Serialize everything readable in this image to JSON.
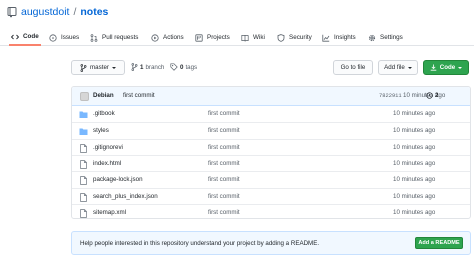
{
  "repo": {
    "owner": "augustdoit",
    "separator": "/",
    "name": "notes"
  },
  "tabs": [
    {
      "label": "Code",
      "icon": "code-icon",
      "active": true
    },
    {
      "label": "Issues",
      "icon": "issue-icon"
    },
    {
      "label": "Pull requests",
      "icon": "pull-request-icon"
    },
    {
      "label": "Actions",
      "icon": "play-icon"
    },
    {
      "label": "Projects",
      "icon": "project-icon"
    },
    {
      "label": "Wiki",
      "icon": "book-icon"
    },
    {
      "label": "Security",
      "icon": "shield-icon"
    },
    {
      "label": "Insights",
      "icon": "graph-icon"
    },
    {
      "label": "Settings",
      "icon": "gear-icon"
    }
  ],
  "toolbar": {
    "branch": "master",
    "branch_count": "1",
    "branch_label": "branch",
    "tag_count": "0",
    "tag_label": "tags",
    "go_to_file": "Go to file",
    "add_file": "Add file",
    "code_button": "Code"
  },
  "commit": {
    "author": "Debian",
    "message": "first commit",
    "sha": "7822911",
    "time": "10 minutes ago",
    "count": "2"
  },
  "files": [
    {
      "type": "folder",
      "name": ".gitbook",
      "commit": "first commit",
      "time": "10 minutes ago"
    },
    {
      "type": "folder",
      "name": "styles",
      "commit": "first commit",
      "time": "10 minutes ago"
    },
    {
      "type": "file",
      "name": ".gitignorevi",
      "commit": "first commit",
      "time": "10 minutes ago"
    },
    {
      "type": "file",
      "name": "index.html",
      "commit": "first commit",
      "time": "10 minutes ago"
    },
    {
      "type": "file",
      "name": "package-lock.json",
      "commit": "first commit",
      "time": "10 minutes ago"
    },
    {
      "type": "file",
      "name": "search_plus_index.json",
      "commit": "first commit",
      "time": "10 minutes ago"
    },
    {
      "type": "file",
      "name": "sitemap.xml",
      "commit": "first commit",
      "time": "10 minutes ago"
    }
  ],
  "readme": {
    "text": "Help people interested in this repository understand your project by adding a README.",
    "button": "Add a README"
  },
  "colors": {
    "link": "#0366d6",
    "folder": "#79b8ff",
    "green": "#2ea44f",
    "active_tab": "#f9826c"
  }
}
